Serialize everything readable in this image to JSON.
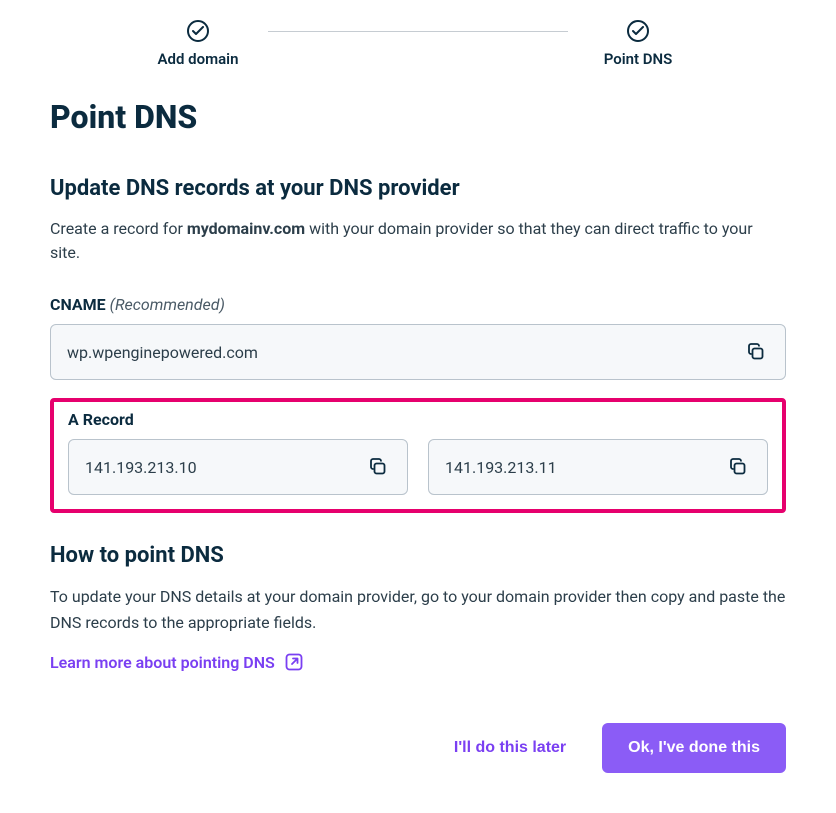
{
  "stepper": {
    "steps": [
      {
        "label": "Add domain"
      },
      {
        "label": "Point DNS"
      }
    ]
  },
  "page": {
    "title": "Point DNS"
  },
  "updateSection": {
    "heading": "Update DNS records at your DNS provider",
    "intro_prefix": "Create a record for ",
    "domain": "mydomainv.com",
    "intro_suffix": " with your domain provider so that they can direct traffic to your site."
  },
  "cname": {
    "label": "CNAME",
    "hint": "(Recommended)",
    "value": "wp.wpenginepowered.com"
  },
  "aRecord": {
    "label": "A Record",
    "values": [
      "141.193.213.10",
      "141.193.213.11"
    ]
  },
  "howto": {
    "heading": "How to point DNS",
    "body": "To update your DNS details at your domain provider, go to your domain provider then copy and paste the DNS records to the appropriate fields.",
    "link_text": "Learn more about pointing DNS"
  },
  "buttons": {
    "later": "I'll do this later",
    "done": "Ok, I've done this"
  }
}
